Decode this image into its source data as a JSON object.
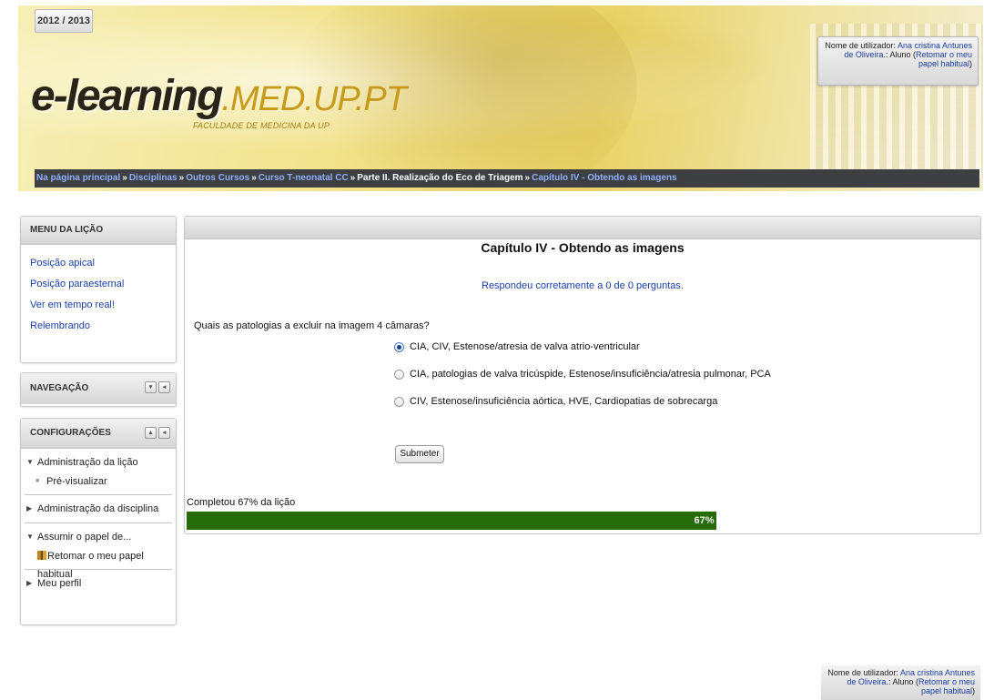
{
  "header": {
    "year": "2012 / 2013",
    "logo_main": "e-learning",
    "logo_domain": ".MED.UP.PT",
    "logo_sub": "FACULDADE DE MEDICINA DA UP",
    "login": {
      "prefix": "Nome de utilizador: ",
      "user": "Ana cristina Antunes de Oliveira",
      "role_text": ".: Aluno (",
      "return_link": "Retomar o meu papel habitual",
      "suffix": ")"
    }
  },
  "breadcrumb": {
    "items": [
      "Na página principal",
      "Disciplinas",
      "Outros Cursos",
      "Curso T-neonatal CC",
      "Parte II. Realização do Eco de Triagem",
      "Capítulo IV - Obtendo as imagens"
    ],
    "separator": "»"
  },
  "lesson_menu": {
    "title": "MENU DA LIÇÃO",
    "items": [
      "Posição apical",
      "Posição paraesternal",
      "Ver em tempo real!",
      "Relembrando"
    ]
  },
  "navigation": {
    "title": "NAVEGAÇÃO"
  },
  "settings": {
    "title": "CONFIGURAÇÕES",
    "lesson_admin": "Administração da lição",
    "preview": "Pré-visualizar",
    "course_admin": "Administração da disciplina",
    "switch_role": "Assumir o papel de...",
    "return_role": "Retomar o meu papel habitual",
    "profile": "Meu perfil"
  },
  "main": {
    "title": "Capítulo IV - Obtendo as imagens",
    "feedback": "Respondeu corretamente a 0 de 0 perguntas.",
    "question": "Quais as patologias a excluir na imagem 4 câmaras?",
    "options": [
      "CIA, CIV, Estenose/atresia de valva atrio-ventricular",
      "CIA, patologias de valva tricúspide, Estenose/insuficiência/atresia pulmonar, PCA",
      "CIV, Estenose/insuficiência aórtica, HVE, Cardiopatias de sobrecarga"
    ],
    "selected_option": 0,
    "submit_label": "Submeter",
    "progress_label": "Completou 67% da lição",
    "progress_percent": 67,
    "progress_text": "67%",
    "progress_color": "#266c0a"
  },
  "footer": {
    "login": {
      "prefix": "Nome de utilizador: ",
      "user": "Ana cristina Antunes de Oliveira",
      "role_text": ".: Aluno (",
      "return_link": "Retomar o meu papel habitual",
      "suffix": ")"
    }
  }
}
